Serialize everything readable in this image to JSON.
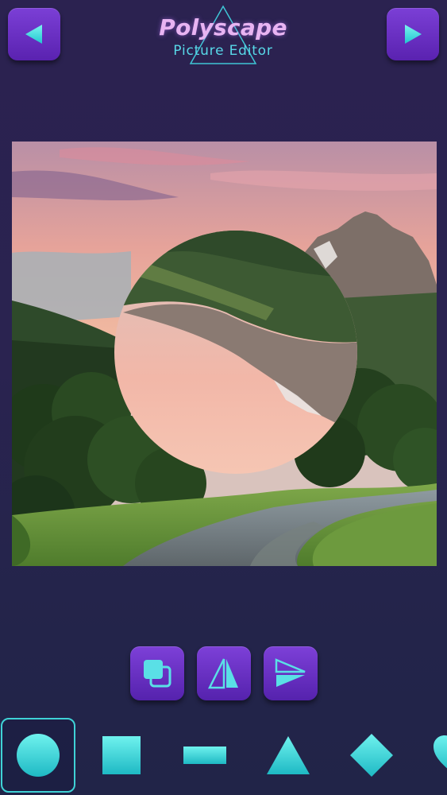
{
  "header": {
    "title": "Polyscape",
    "subtitle": "Picture Editor",
    "back_icon": "play-left-icon",
    "forward_icon": "play-right-icon"
  },
  "canvas": {
    "description_icon": "photo-canvas",
    "mask_shape": "circle",
    "mask_effect": "mirror-flip"
  },
  "tools": [
    {
      "name": "layer-copy-icon"
    },
    {
      "name": "mirror-vertical-icon"
    },
    {
      "name": "mirror-horizontal-icon"
    }
  ],
  "shapes": [
    {
      "name": "circle",
      "selected": true
    },
    {
      "name": "square",
      "selected": false
    },
    {
      "name": "rectangle",
      "selected": false
    },
    {
      "name": "triangle",
      "selected": false
    },
    {
      "name": "diamond",
      "selected": false
    },
    {
      "name": "heart",
      "selected": false
    }
  ],
  "colors": {
    "accent_purple": "#6a2fc4",
    "accent_cyan": "#3fd2d6",
    "background": "#2a2350",
    "title_pink": "#e8b4f2"
  }
}
